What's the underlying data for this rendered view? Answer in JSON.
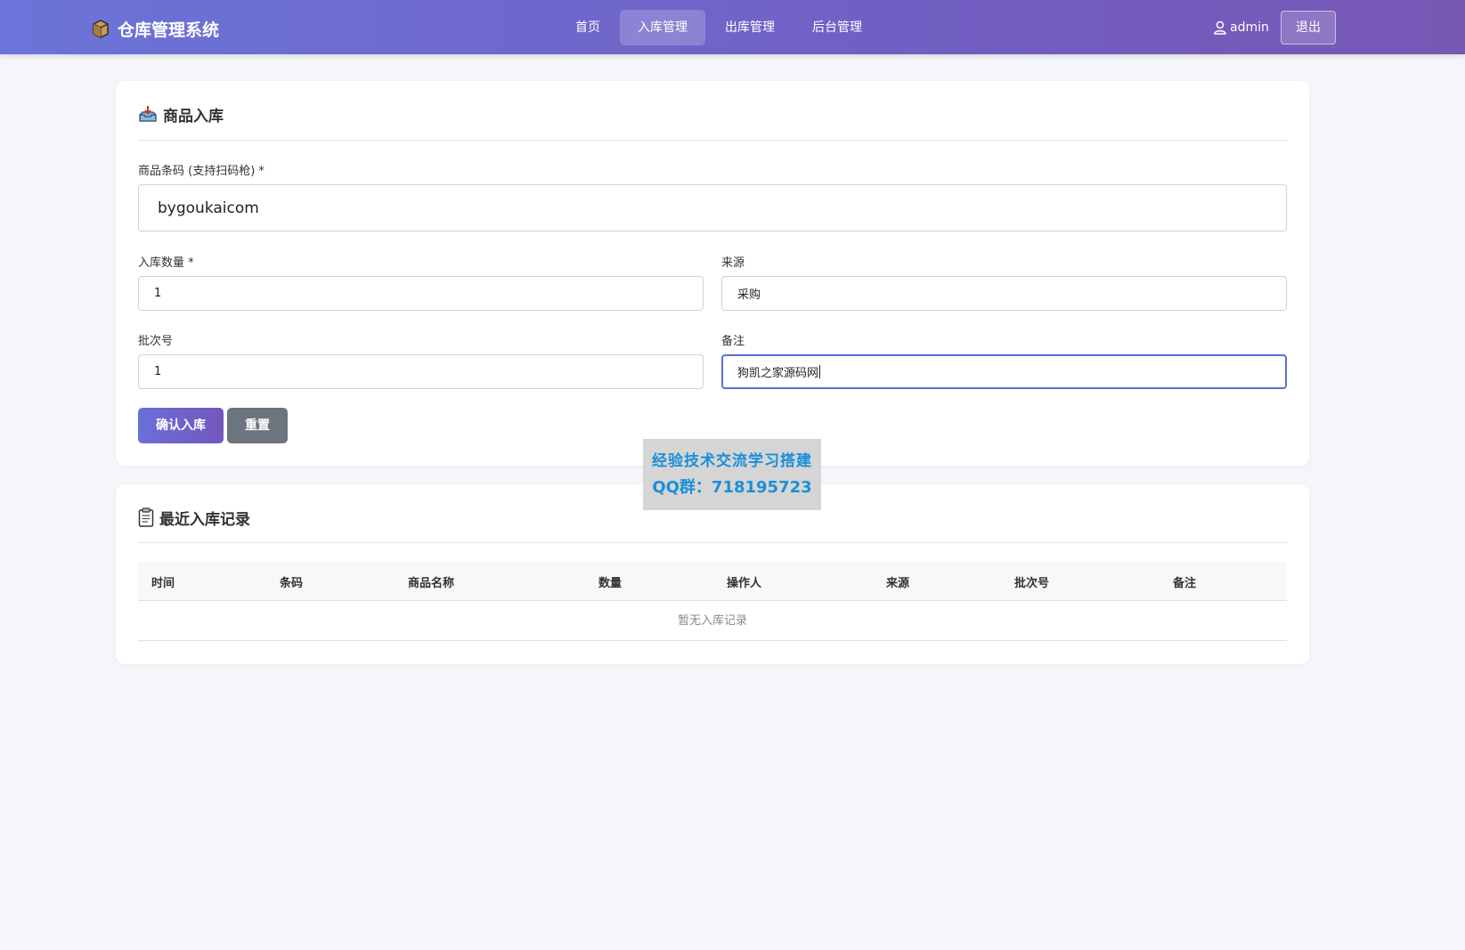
{
  "header": {
    "brand": "仓库管理系统",
    "nav": [
      {
        "label": "首页",
        "active": false
      },
      {
        "label": "入库管理",
        "active": true
      },
      {
        "label": "出库管理",
        "active": false
      },
      {
        "label": "后台管理",
        "active": false
      }
    ],
    "username": "admin",
    "logout_label": "退出"
  },
  "inbound_form": {
    "title": "商品入库",
    "barcode_label": "商品条码 (支持扫码枪) *",
    "barcode_value": "bygoukaicom",
    "quantity_label": "入库数量 *",
    "quantity_value": "1",
    "source_label": "来源",
    "source_value": "采购",
    "batch_label": "批次号",
    "batch_value": "1",
    "remark_label": "备注",
    "remark_value": "狗凯之家源码网",
    "confirm_label": "确认入库",
    "reset_label": "重置"
  },
  "records": {
    "title": "最近入库记录",
    "columns": [
      "时间",
      "条码",
      "商品名称",
      "数量",
      "操作人",
      "来源",
      "批次号",
      "备注"
    ],
    "empty_text": "暂无入库记录"
  },
  "watermark": {
    "line1": "经验技术交流学习搭建",
    "line2": "QQ群：718195723"
  },
  "colors": {
    "header_gradient_start": "#6b74d8",
    "header_gradient_end": "#7757b4",
    "focus_border": "#5a6fd3",
    "secondary_button": "#6c757d",
    "watermark_text": "#1a8fd9"
  }
}
